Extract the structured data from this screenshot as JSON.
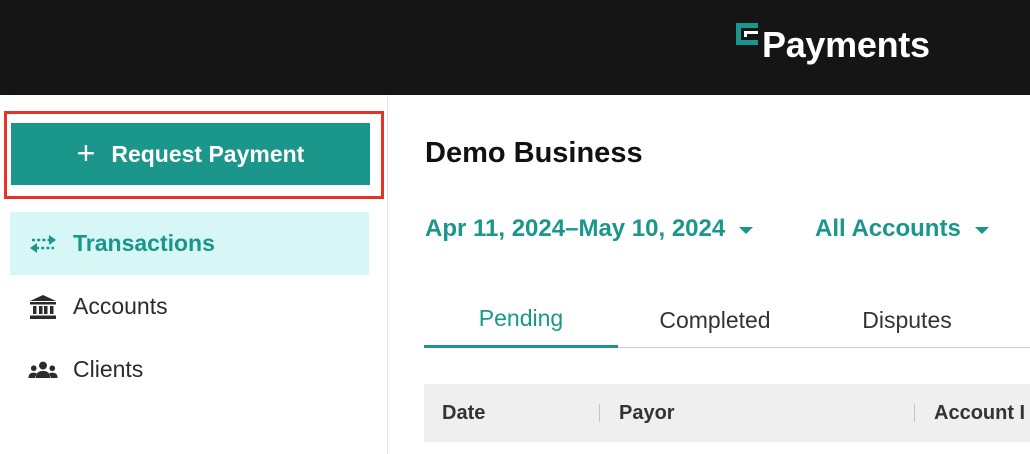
{
  "header": {
    "brand_name": "Payments",
    "logo_icon": "brand-logo-icon",
    "background_color": "#151515"
  },
  "sidebar": {
    "request_button": {
      "label": "Request Payment",
      "icon": "plus-icon",
      "color": "#1a968b"
    },
    "highlight_color": "#e5332a",
    "items": [
      {
        "label": "Transactions",
        "icon": "transfer-arrows-icon",
        "active": true
      },
      {
        "label": "Accounts",
        "icon": "bank-icon",
        "active": false
      },
      {
        "label": "Clients",
        "icon": "users-icon",
        "active": false
      }
    ]
  },
  "main": {
    "title": "Demo Business",
    "filters": {
      "date_range": "Apr 11, 2024–May 10, 2024",
      "accounts": "All Accounts"
    },
    "tabs": [
      {
        "label": "Pending",
        "active": true
      },
      {
        "label": "Completed",
        "active": false
      },
      {
        "label": "Disputes",
        "active": false
      }
    ],
    "table": {
      "columns": [
        "Date",
        "Payor",
        "Account I"
      ]
    }
  },
  "colors": {
    "accent": "#1a968b",
    "active_nav_bg": "#d7f7f6"
  }
}
